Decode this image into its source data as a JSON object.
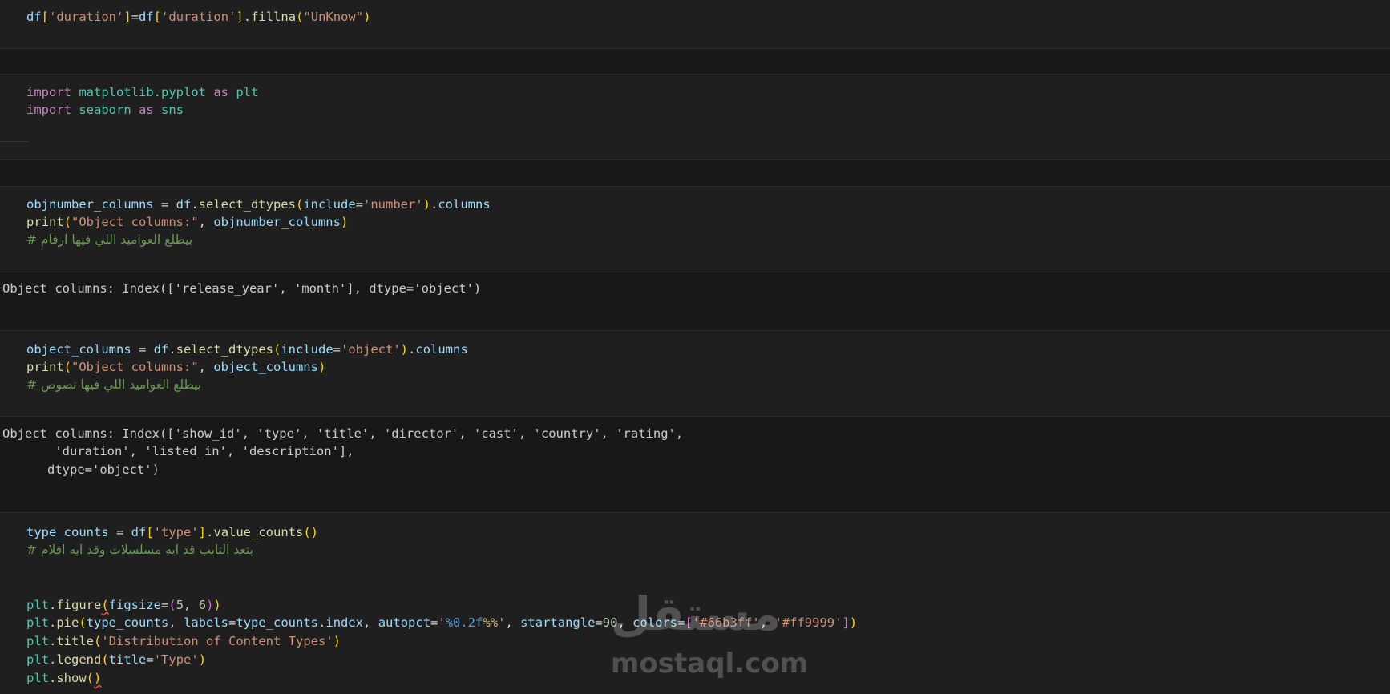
{
  "cells": {
    "fillna": {
      "line1": {
        "a": "df",
        "b": "[",
        "c": "'duration'",
        "d": "]",
        "e": "=",
        "f": "df",
        "g": "[",
        "h": "'duration'",
        "i": "]",
        "j": ".",
        "k": "fillna",
        "l": "(",
        "m": "\"UnKnow\"",
        "n": ")"
      }
    },
    "imports": {
      "line1": {
        "kw1": "import",
        "mod": "matplotlib.pyplot",
        "kw2": "as",
        "alias": "plt"
      },
      "line2": {
        "kw1": "import",
        "mod": "seaborn",
        "kw2": "as",
        "alias": "sns"
      }
    },
    "number_cols": {
      "line1": {
        "a": "objnumber_columns",
        "b": " = ",
        "c": "df",
        "d": ".",
        "e": "select_dtypes",
        "f": "(",
        "g": "include",
        "h": "=",
        "i": "'number'",
        "j": ")",
        "k": ".",
        "l": "columns"
      },
      "line2": {
        "a": "print",
        "b": "(",
        "c": "\"Object columns:\"",
        "d": ", ",
        "e": "objnumber_columns",
        "f": ")"
      },
      "line3": "# بيطلع العواميد اللي فيها ارقام",
      "output": "Object columns: Index(['release_year', 'month'], dtype='object')"
    },
    "object_cols": {
      "line1": {
        "a": "object_columns",
        "b": " = ",
        "c": "df",
        "d": ".",
        "e": "select_dtypes",
        "f": "(",
        "g": "include",
        "h": "=",
        "i": "'object'",
        "j": ")",
        "k": ".",
        "l": "columns"
      },
      "line2": {
        "a": "print",
        "b": "(",
        "c": "\"Object columns:\"",
        "d": ", ",
        "e": "object_columns",
        "f": ")"
      },
      "line3": "# بيطلع العواميد اللي فيها نصوص",
      "output1": "Object columns: Index(['show_id', 'type', 'title', 'director', 'cast', 'country', 'rating',",
      "output2": "       'duration', 'listed_in', 'description'],",
      "output3": "      dtype='object')"
    },
    "pie": {
      "line1": {
        "a": "type_counts",
        "b": " = ",
        "c": "df",
        "d": "[",
        "e": "'type'",
        "f": "]",
        "g": ".",
        "h": "value_counts",
        "i": "()"
      },
      "line2": "# بتعد التايب قد ايه مسلسلات وقد ايه افلام",
      "line3": {
        "a": "plt",
        "b": ".",
        "c": "figure",
        "d": "(",
        "e": "figsize",
        "f": "=",
        "g": "(",
        "h": "5",
        "i": ", ",
        "j": "6",
        "k": ")",
        "l": ")"
      },
      "line4": {
        "a": "plt",
        "b": ".",
        "c": "pie",
        "d": "(",
        "e": "type_counts",
        "f": ", ",
        "g": "labels",
        "h": "=",
        "i": "type_counts",
        "j": ".",
        "k": "index",
        "l": ", ",
        "m": "autopct",
        "n": "=",
        "o": "'",
        "p": "%0.2f",
        "q": "%%",
        "r": "'",
        "s": ", ",
        "t": "startangle",
        "u": "=",
        "v": "90",
        "w": ", ",
        "x": "colors",
        "y": "=",
        "z": "[",
        "aa": "'#66b3ff'",
        "ab": ", ",
        "ac": "'#ff9999'",
        "ad": "]",
        "ae": ")"
      },
      "line5": {
        "a": "plt",
        "b": ".",
        "c": "title",
        "d": "(",
        "e": "'Distribution of Content Types'",
        "f": ")"
      },
      "line6": {
        "a": "plt",
        "b": ".",
        "c": "legend",
        "d": "(",
        "e": "title",
        "f": "=",
        "g": "'Type'",
        "h": ")"
      },
      "line7": {
        "a": "plt",
        "b": ".",
        "c": "show",
        "d": "(",
        "e": ")"
      }
    }
  },
  "watermark": {
    "arabic": "مستقل",
    "latin": "mostaql.com"
  }
}
